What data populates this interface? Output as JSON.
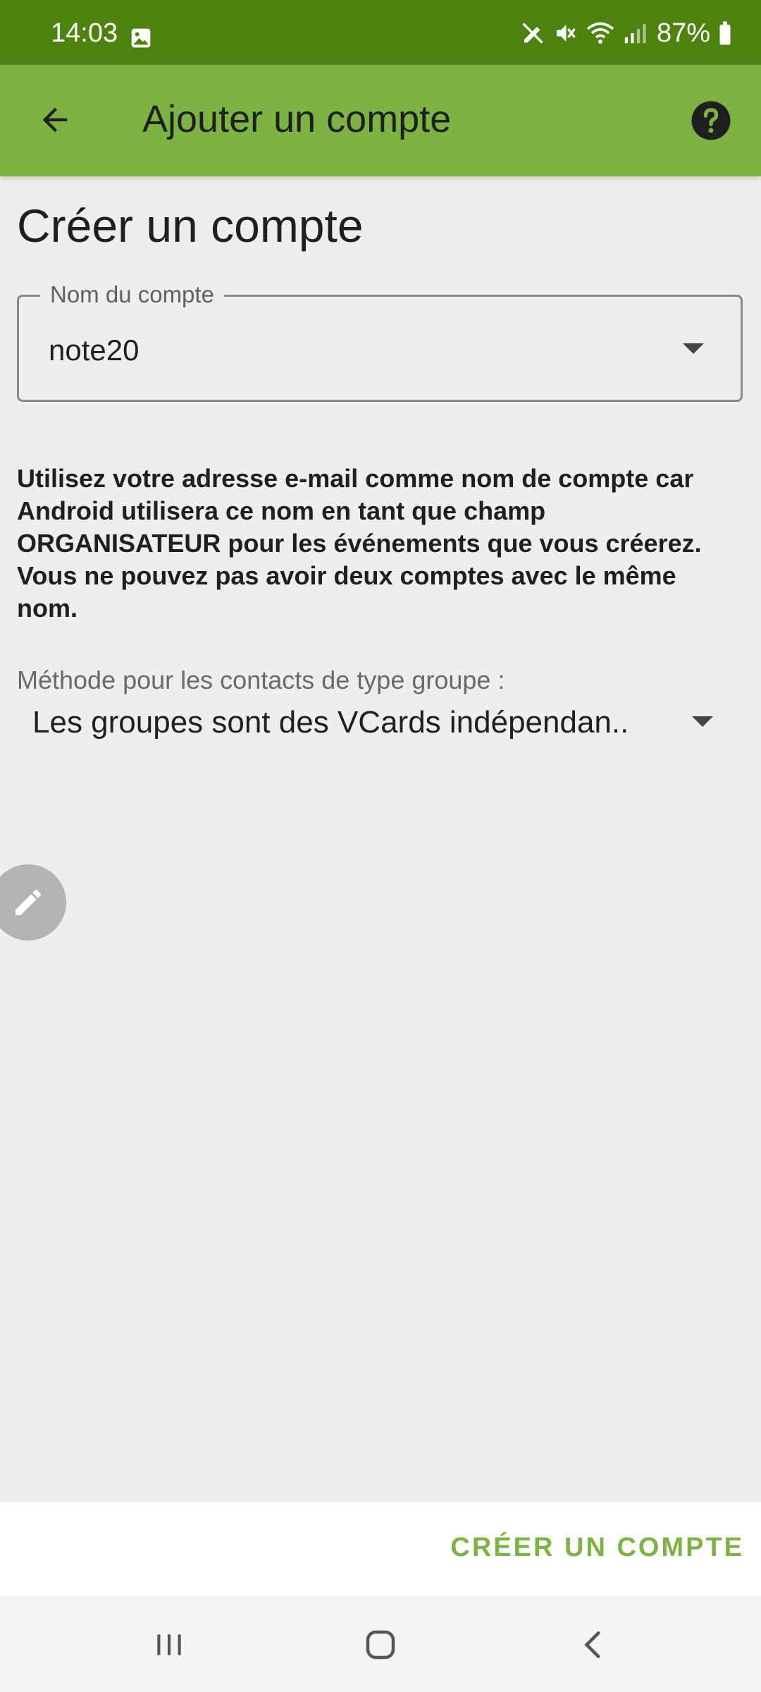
{
  "status_bar": {
    "time": "14:03",
    "battery": "87%",
    "icons": [
      "image-icon",
      "no-alarm-icon",
      "mute-icon",
      "wifi-icon",
      "signal-icon",
      "battery-icon"
    ]
  },
  "app_bar": {
    "title": "Ajouter un compte",
    "back_icon": "arrow-back-icon",
    "help_icon": "help-circle-icon"
  },
  "main": {
    "heading": "Créer un compte",
    "account_field": {
      "label": "Nom du compte",
      "value": "note20"
    },
    "info_text": "Utilisez votre adresse e-mail comme nom de compte car Android utilisera ce nom en tant que champ ORGANISATEUR pour les événements que vous créerez. Vous ne pouvez pas avoir deux comptes avec le même nom.",
    "group_method": {
      "label": "Méthode pour les contacts de type groupe :",
      "value": "Les groupes sont des VCards indépendan.."
    },
    "fab_icon": "pencil-icon"
  },
  "action_bar": {
    "create_button": "CRÉER UN COMPTE"
  },
  "nav_bar": {
    "icons": [
      "recent-apps-icon",
      "home-icon",
      "back-icon"
    ]
  },
  "colors": {
    "status_bar": "#4c830f",
    "app_bar": "#7cb342",
    "accent": "#7cb342",
    "background": "#eeeeee"
  }
}
